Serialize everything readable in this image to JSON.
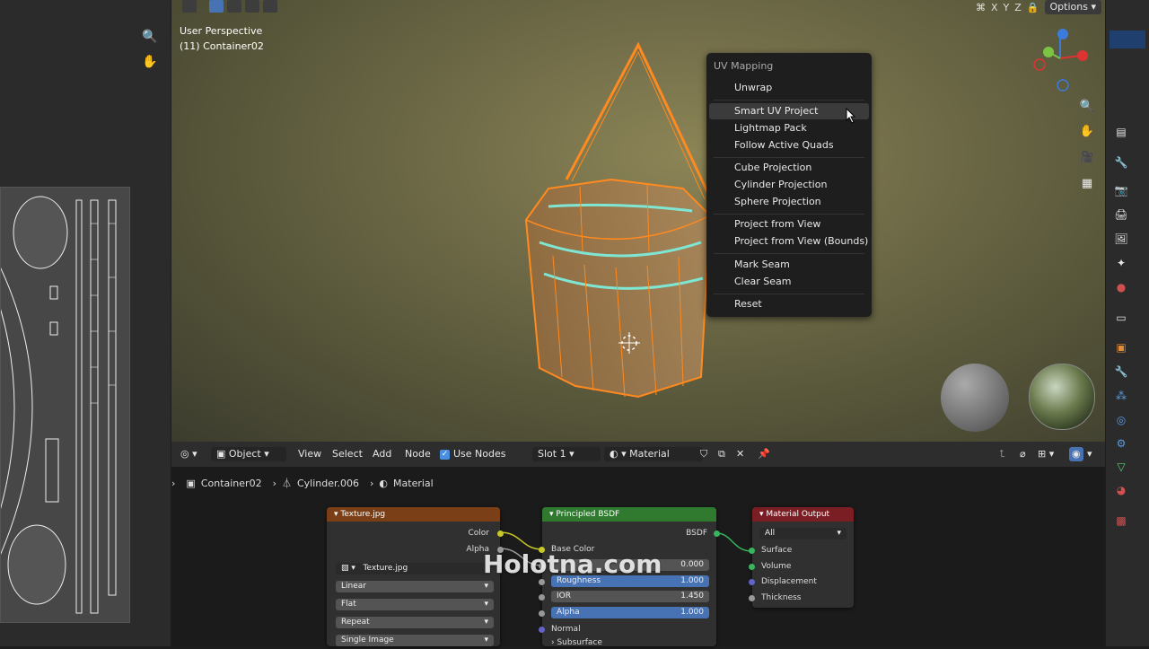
{
  "viewport": {
    "perspective_label": "User Perspective",
    "object_label": "(11) Container02",
    "axes": [
      "X",
      "Y",
      "Z"
    ],
    "options_label": "Options"
  },
  "uv_menu": {
    "title": "UV Mapping",
    "items": [
      {
        "label": "Unwrap"
      },
      {
        "label": "Smart UV Project"
      },
      {
        "label": "Lightmap Pack"
      },
      {
        "label": "Follow Active Quads"
      },
      {
        "label": "Cube Projection"
      },
      {
        "label": "Cylinder Projection"
      },
      {
        "label": "Sphere Projection"
      },
      {
        "label": "Project from View"
      },
      {
        "label": "Project from View (Bounds)"
      },
      {
        "label": "Mark Seam"
      },
      {
        "label": "Clear Seam"
      },
      {
        "label": "Reset"
      }
    ],
    "highlighted": "Smart UV Project"
  },
  "node_header": {
    "mode": "Object",
    "view": "View",
    "select": "Select",
    "add": "Add",
    "node": "Node",
    "use_nodes": "Use Nodes",
    "slot": "Slot 1",
    "material": "Material"
  },
  "breadcrumb": {
    "object": "Container02",
    "mesh": "Cylinder.006",
    "material": "Material"
  },
  "nodes": {
    "texture": {
      "title": "Texture.jpg",
      "out_color": "Color",
      "out_alpha": "Alpha",
      "image": "Texture.jpg",
      "interpolation": "Linear",
      "projection": "Flat",
      "extension": "Repeat",
      "source": "Single Image"
    },
    "bsdf": {
      "title": "Principled BSDF",
      "out_bsdf": "BSDF",
      "base_color": "Base Color",
      "metallic_value": "0.000",
      "roughness": "Roughness",
      "roughness_value": "1.000",
      "ior": "IOR",
      "ior_value": "1.450",
      "alpha": "Alpha",
      "alpha_value": "1.000",
      "normal": "Normal",
      "subsurface": "Subsurface"
    },
    "output": {
      "title": "Material Output",
      "target": "All",
      "surface": "Surface",
      "volume": "Volume",
      "displacement": "Displacement",
      "thickness": "Thickness"
    }
  },
  "watermark": "Holotna.com",
  "colors": {
    "accent": "#4772b3",
    "selection_orange": "#ff8a1f",
    "seam_cyan": "#7fe6d4",
    "texture_header": "#7a3f16",
    "bsdf_header": "#2f7a2f",
    "output_header": "#7a1e24"
  }
}
